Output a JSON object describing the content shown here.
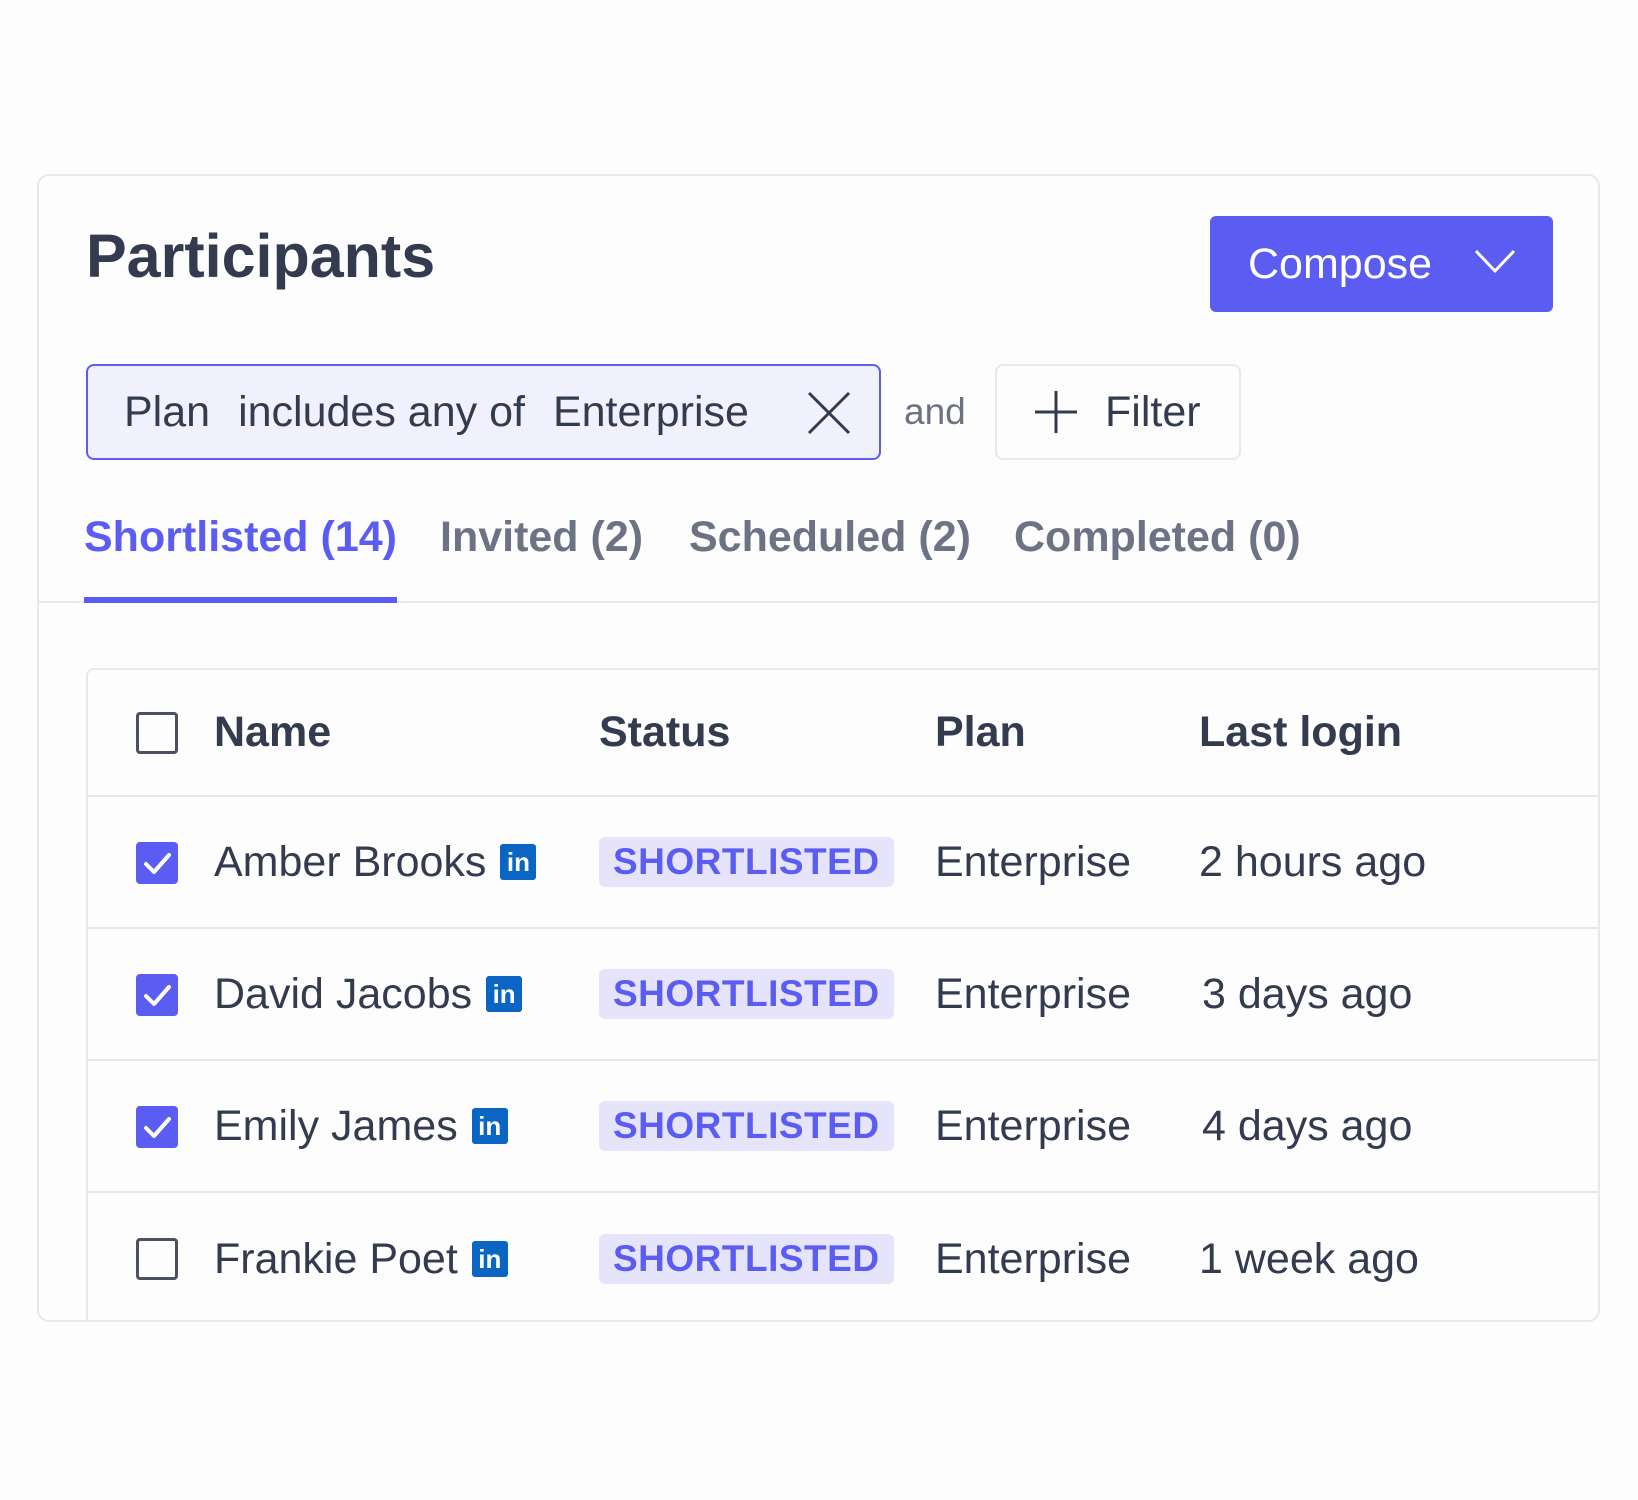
{
  "header": {
    "title": "Participants",
    "compose_label": "Compose"
  },
  "filter": {
    "field": "Plan",
    "operator": "includes any of",
    "value": "Enterprise",
    "conjunction": "and",
    "add_label": "Filter"
  },
  "tabs": [
    {
      "label": "Shortlisted (14)",
      "active": true
    },
    {
      "label": "Invited (2)",
      "active": false
    },
    {
      "label": "Scheduled (2)",
      "active": false
    },
    {
      "label": "Completed (0)",
      "active": false
    }
  ],
  "table": {
    "columns": [
      "Name",
      "Status",
      "Plan",
      "Last login"
    ],
    "rows": [
      {
        "name": "Amber Brooks",
        "status": "SHORTLISTED",
        "plan": "Enterprise",
        "last_login": "2 hours ago",
        "checked": true
      },
      {
        "name": "David Jacobs",
        "status": "SHORTLISTED",
        "plan": "Enterprise",
        "last_login": "3 days ago",
        "checked": true
      },
      {
        "name": "Emily James",
        "status": "SHORTLISTED",
        "plan": "Enterprise",
        "last_login": "4 days ago",
        "checked": true
      },
      {
        "name": "Frankie Poet",
        "status": "SHORTLISTED",
        "plan": "Enterprise",
        "last_login": "1 week ago",
        "checked": false
      }
    ],
    "linkedin_label": "in"
  },
  "colors": {
    "accent": "#5a5cf2",
    "text": "#333b4f",
    "muted": "#6b7384",
    "badge_bg": "#e5e4fb",
    "linkedin": "#0a66c2",
    "border": "#e6e8ec"
  }
}
